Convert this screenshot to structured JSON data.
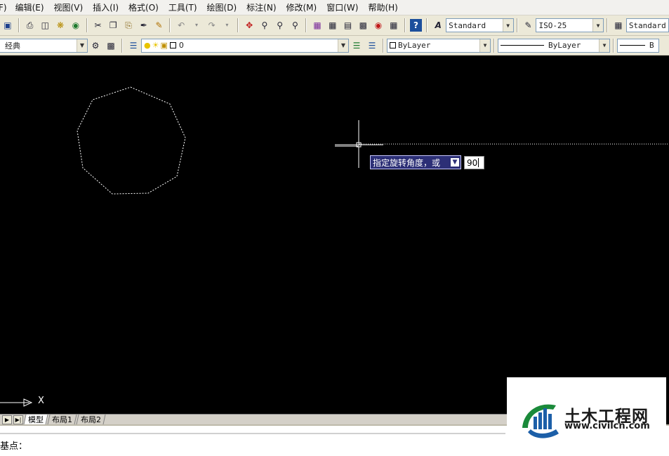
{
  "menu": {
    "items": [
      "F)",
      "编辑(E)",
      "视图(V)",
      "插入(I)",
      "格式(O)",
      "工具(T)",
      "绘图(D)",
      "标注(N)",
      "修改(M)",
      "窗口(W)",
      "帮助(H)"
    ]
  },
  "toolbar": {
    "text_style": "Standard",
    "dim_style": "ISO-25",
    "table_style": "Standard"
  },
  "toolbar2": {
    "workspace": "经典",
    "layer": "0",
    "color": "ByLayer",
    "linetype": "ByLayer",
    "lineweight": "B"
  },
  "canvas": {
    "background": "#000000",
    "prompt_text": "指定旋转角度，或",
    "angle_value": "90",
    "ucs_label": "X"
  },
  "tabs": {
    "items": [
      "模型",
      "布局1",
      "布局2"
    ],
    "active": "模型"
  },
  "command": {
    "text": "基点："
  },
  "watermark": {
    "name": "土木工程网",
    "url": "www.civilcn.com"
  },
  "colors": {
    "toolbar_bg": "#ece9d8",
    "tooltip_bg": "#2c2f76",
    "canvas": "#000000"
  }
}
